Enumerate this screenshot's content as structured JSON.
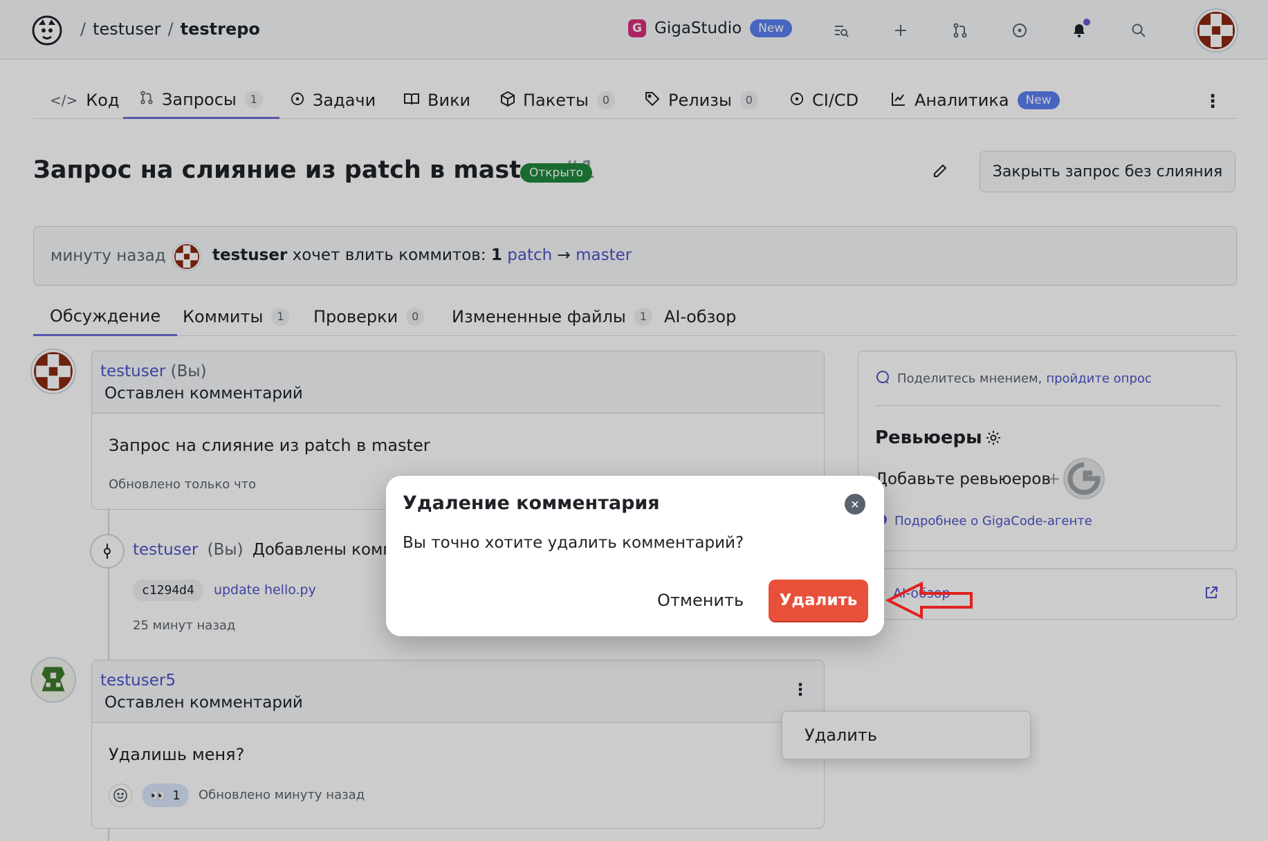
{
  "header": {
    "owner": "testuser",
    "repo": "testrepo",
    "sep1": "/",
    "sep2": "/",
    "gigastudio": {
      "label": "GigaStudio",
      "badge": "New",
      "icon_letter": "G"
    },
    "icons": [
      "search-code-icon",
      "plus-icon",
      "pull-request-icon",
      "issue-icon",
      "bell-icon",
      "search-icon"
    ]
  },
  "repo_tabs": [
    {
      "label": "Код",
      "icon": "code-icon"
    },
    {
      "label": "Запросы",
      "icon": "pull-request-icon",
      "count": "1"
    },
    {
      "label": "Задачи",
      "icon": "issue-icon"
    },
    {
      "label": "Вики",
      "icon": "book-icon"
    },
    {
      "label": "Пакеты",
      "icon": "package-icon",
      "count": "0"
    },
    {
      "label": "Релизы",
      "icon": "tag-icon",
      "count": "0"
    },
    {
      "label": "CI/CD",
      "icon": "ci-icon"
    },
    {
      "label": "Аналитика",
      "icon": "chart-icon",
      "badge": "New"
    }
  ],
  "pr": {
    "title": "Запрос на слияние из patch в master",
    "number": "#1",
    "status": "Открыто",
    "close_button": "Закрыть запрос без слияния"
  },
  "info": {
    "when": "минуту назад",
    "user": "testuser",
    "text": "хочет влить коммитов:",
    "commit_count": "1",
    "from_branch": "patch",
    "arrow": "→",
    "to_branch": "master"
  },
  "pr_tabs": [
    {
      "label": "Обсуждение"
    },
    {
      "label": "Коммиты",
      "count": "1"
    },
    {
      "label": "Проверки",
      "count": "0"
    },
    {
      "label": "Измененные файлы",
      "count": "1"
    },
    {
      "label": "AI-обзор"
    }
  ],
  "comment1": {
    "author": "testuser",
    "you": "(Вы)",
    "action": "Оставлен комментарий",
    "body": "Запрос на слияние из patch в master",
    "updated": "Обновлено только что"
  },
  "commit_event": {
    "author": "testuser",
    "you": "(Вы)",
    "action": "Добавлены комми",
    "sha": "c1294d4",
    "message": "update hello.py",
    "time": "25 минут назад"
  },
  "comment2": {
    "author": "testuser5",
    "action": "Оставлен комментарий",
    "body": "Удалишь меня?",
    "reaction_emoji": "👀",
    "reaction_count": "1",
    "updated": "Обновлено минуту назад"
  },
  "sidebar": {
    "feedback_text": "Поделитесь мнением,",
    "feedback_link": "пройдите опрос",
    "reviewers_title": "Ревьюеры",
    "add_reviewers": "Добавьте ревьюеров",
    "plus": "+",
    "gigacode_link": "Подробнее о GigaCode-агенте",
    "ai_review": "AI-обзор"
  },
  "menu": {
    "delete_item": "Удалить"
  },
  "modal": {
    "title": "Удаление комментария",
    "message": "Вы точно хотите удалить комментарий?",
    "cancel": "Отменить",
    "confirm": "Удалить"
  },
  "colors": {
    "accent": "#6c6ad6",
    "link": "#4d54c7",
    "open_status": "#1f883d",
    "danger": "#e8503a",
    "annotation_arrow": "#e02020"
  }
}
